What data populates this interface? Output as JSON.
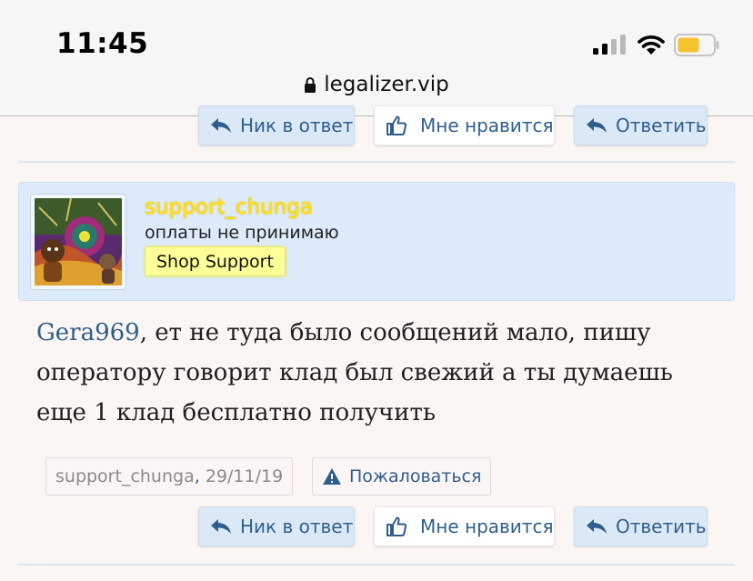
{
  "status_bar": {
    "time": "11:45"
  },
  "browser": {
    "url": "legalizer.vip"
  },
  "top_actions": {
    "reply_nick": "Ник в ответ",
    "like": "Мне нравится",
    "reply": "Ответить"
  },
  "post": {
    "username": "support_chunga",
    "user_title": "оплаты не принимаю",
    "user_badge": "Shop Support",
    "mention": "Gera969",
    "message": ", ет не туда было сообщений мало, пишу оператору говорит клад был свежий а ты думаешь еще 1 клад бесплатно получить",
    "meta_author": "support_chunga",
    "meta_sep": ",",
    "meta_date": "29/11/19",
    "report_label": "Пожаловаться",
    "actions": {
      "reply_nick": "Ник в ответ",
      "like": "Мне нравится",
      "reply": "Ответить"
    }
  },
  "colors": {
    "page_bg": "#fbf5f4",
    "link_blue": "#2f5e8c",
    "userbar_bg": "#dceafa",
    "username_yellow": "#ffe11a",
    "badge_bg": "#ffff99"
  }
}
